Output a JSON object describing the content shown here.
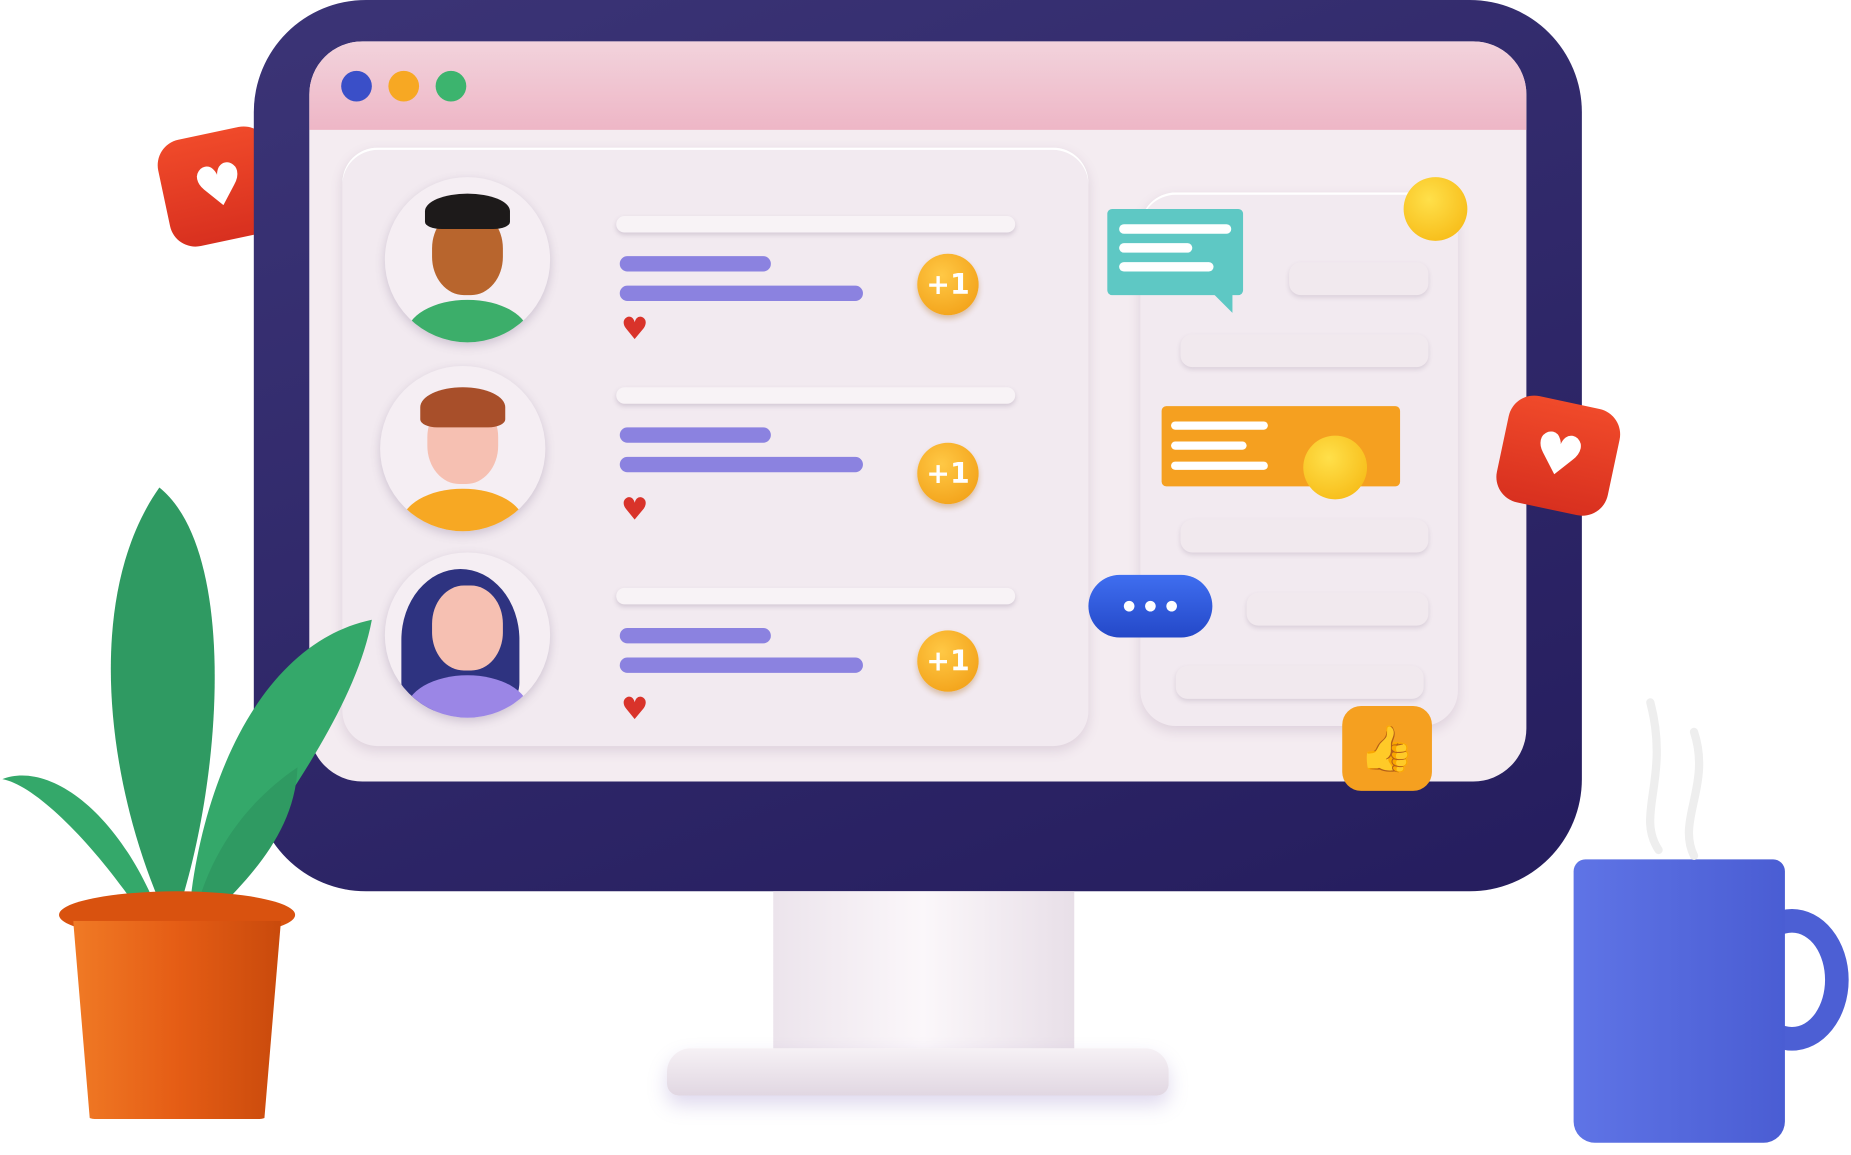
{
  "window_dots": {
    "colors": [
      "#3a4fc8",
      "#f7a823",
      "#3cb46e"
    ]
  },
  "feed": {
    "posts": [
      {
        "avatar": "man-curly-hair-glasses",
        "badge": "+1",
        "reaction": "heart-icon"
      },
      {
        "avatar": "man-brown-hair",
        "badge": "+1",
        "reaction": "heart-icon"
      },
      {
        "avatar": "woman-dark-hair",
        "badge": "+1",
        "reaction": "heart-icon"
      }
    ]
  },
  "colors": {
    "frame": "#2b2266",
    "screen": "#f4ecf1",
    "accent_purple": "#8b82e0",
    "badge": "#f5a91a",
    "heart": "#d9332a",
    "mug": "#5a6ee0",
    "pot": "#e5621a"
  }
}
